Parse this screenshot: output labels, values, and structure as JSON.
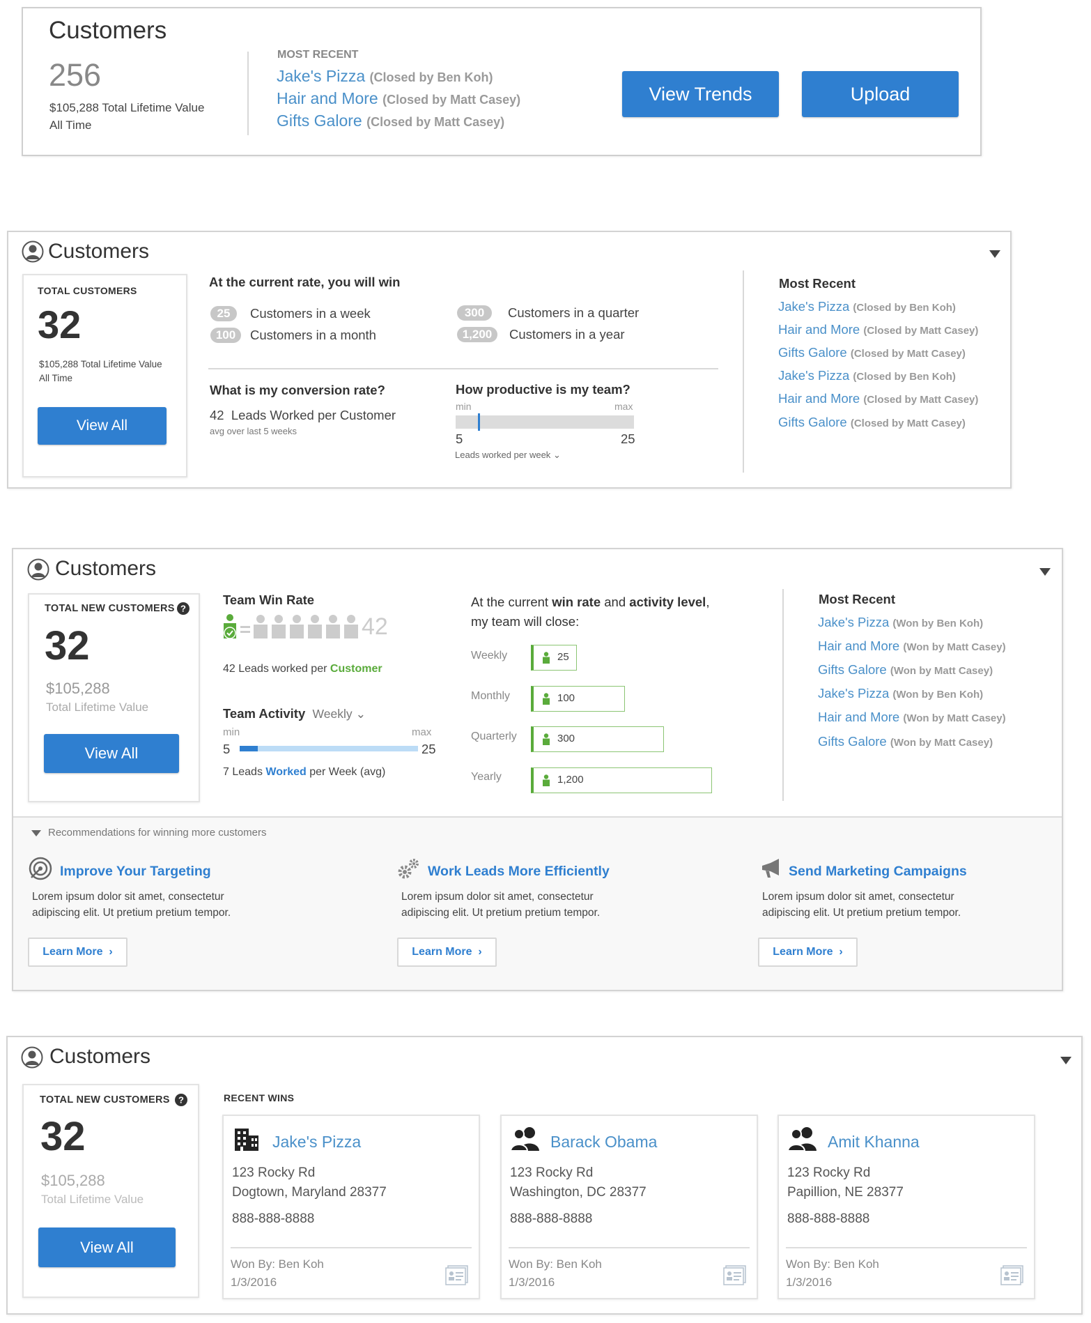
{
  "w1": {
    "title": "Customers",
    "count": "256",
    "ltv": "$105,288 Total Lifetime Value",
    "period": "All Time",
    "recent_heading": "MOST RECENT",
    "recent": [
      {
        "name": "Jake's Pizza",
        "closer": "(Closed by Ben Koh)"
      },
      {
        "name": "Hair and More",
        "closer": "(Closed by Matt Casey)"
      },
      {
        "name": "Gifts Galore",
        "closer": "(Closed by Matt Casey)"
      }
    ],
    "view_trends": "View Trends",
    "upload": "Upload"
  },
  "w2": {
    "title": "Customers",
    "total_label": "TOTAL CUSTOMERS",
    "count": "32",
    "ltv": "$105,288 Total Lifetime Value",
    "period": "All Time",
    "view_all": "View All",
    "rate_heading": "At the current rate, you will win",
    "rates": [
      {
        "value": "25",
        "label": "Customers in a week"
      },
      {
        "value": "100",
        "label": "Customers in a month"
      },
      {
        "value": "300",
        "label": "Customers in a quarter"
      },
      {
        "value": "1,200",
        "label": "Customers in a year"
      }
    ],
    "conv_heading": "What is my conversion rate?",
    "conv_value": "42",
    "conv_text": "Leads Worked per Customer",
    "conv_sub": "avg over last 5 weeks",
    "prod_heading": "How productive is my team?",
    "min_label": "min",
    "max_label": "max",
    "min_val": "5",
    "max_val": "25",
    "prod_fraction": 0.125,
    "prod_select": "Leads worked per week",
    "recent_heading": "Most Recent",
    "recent": [
      {
        "name": "Jake's Pizza",
        "closer": "(Closed by Ben Koh)"
      },
      {
        "name": "Hair and More",
        "closer": "(Closed by Matt Casey)"
      },
      {
        "name": "Gifts Galore",
        "closer": "(Closed by Matt Casey)"
      },
      {
        "name": "Jake's Pizza",
        "closer": "(Closed by Ben Koh)"
      },
      {
        "name": "Hair and More",
        "closer": "(Closed by Matt Casey)"
      },
      {
        "name": "Gifts Galore",
        "closer": "(Closed by Matt Casey)"
      }
    ]
  },
  "w3": {
    "title": "Customers",
    "total_label": "TOTAL NEW CUSTOMERS",
    "count": "32",
    "ltv_amount": "$105,288",
    "ltv_label": "Total Lifetime Value",
    "view_all": "View All",
    "win_heading": "Team Win Rate",
    "win_number": "42",
    "win_text_pre": "42 Leads worked per",
    "win_text_em": "Customer",
    "activity_heading": "Team Activity",
    "activity_select": "Weekly",
    "min_label": "min",
    "max_label": "max",
    "min_val": "5",
    "max_val": "25",
    "activity_fraction": 0.1,
    "activity_text_pre": "7 Leads",
    "activity_text_em": "Worked",
    "activity_text_post": "per Week (avg)",
    "close_pre": "At the current",
    "close_b1": "win rate",
    "close_mid": "and",
    "close_b2": "activity level",
    "close_post": ",",
    "close_line2": "my team will close:",
    "bars": [
      {
        "label": "Weekly",
        "value": "25",
        "num": 25
      },
      {
        "label": "Monthly",
        "value": "100",
        "num": 100
      },
      {
        "label": "Quarterly",
        "value": "300",
        "num": 300
      },
      {
        "label": "Yearly",
        "value": "1,200",
        "num": 1200
      }
    ],
    "recent_heading": "Most Recent",
    "recent": [
      {
        "name": "Jake's Pizza",
        "closer": "(Won by Ben Koh)"
      },
      {
        "name": "Hair and More",
        "closer": "(Won by Matt Casey)"
      },
      {
        "name": "Gifts Galore",
        "closer": "(Won by Matt Casey)"
      },
      {
        "name": "Jake's Pizza",
        "closer": "(Won by Ben Koh)"
      },
      {
        "name": "Hair and More",
        "closer": "(Won by Matt Casey)"
      },
      {
        "name": "Gifts Galore",
        "closer": "(Won by Matt Casey)"
      }
    ],
    "reco_heading": "Recommendations for winning more customers",
    "recos": [
      {
        "title": "Improve Your Targeting",
        "line1": "Lorem ipsum dolor sit amet, consectetur",
        "line2": "adipiscing elit. Ut pretium pretium tempor.",
        "button": "Learn More"
      },
      {
        "title": "Work Leads More Efficiently",
        "line1": "Lorem ipsum dolor sit amet, consectetur",
        "line2": "adipiscing elit. Ut pretium pretium tempor.",
        "button": "Learn More"
      },
      {
        "title": "Send Marketing Campaigns",
        "line1": "Lorem ipsum dolor sit amet, consectetur",
        "line2": "adipiscing elit. Ut pretium pretium tempor.",
        "button": "Learn More"
      }
    ]
  },
  "w4": {
    "title": "Customers",
    "total_label": "TOTAL NEW CUSTOMERS",
    "count": "32",
    "ltv_amount": "$105,288",
    "ltv_label": "Total Lifetime Value",
    "view_all": "View All",
    "wins_heading": "RECENT WINS",
    "wins": [
      {
        "icon": "building-icon",
        "name": "Jake's Pizza",
        "street": "123 Rocky Rd",
        "city": "Dogtown, Maryland 28377",
        "phone": "888-888-8888",
        "won_by": "Won By: Ben Koh",
        "date": "1/3/2016"
      },
      {
        "icon": "people-icon",
        "name": "Barack Obama",
        "street": "123 Rocky Rd",
        "city": "Washington, DC 28377",
        "phone": "888-888-8888",
        "won_by": "Won By: Ben Koh",
        "date": "1/3/2016"
      },
      {
        "icon": "people-icon",
        "name": "Amit Khanna",
        "street": "123 Rocky Rd",
        "city": "Papillion, NE 28377",
        "phone": "888-888-8888",
        "won_by": "Won By: Ben Koh",
        "date": "1/3/2016"
      }
    ]
  },
  "colors": {
    "accent": "#2f7fd0",
    "link": "#4a90c9",
    "green": "#5aab3b",
    "border": "#d3d3d3"
  }
}
